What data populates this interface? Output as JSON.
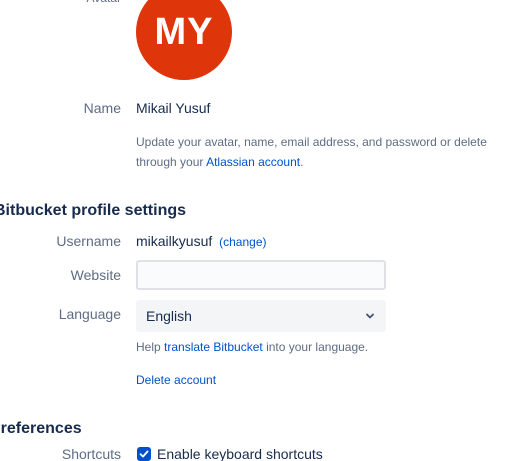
{
  "account": {
    "avatar_label": "Avatar",
    "avatar_initials": "MY",
    "avatar_color": "#de350b",
    "name_label": "Name",
    "name_value": "Mikail Yusuf",
    "help_line1": "Update your avatar, name, email address, and password or delete",
    "help_line2_prefix": "through your ",
    "help_link": "Atlassian account",
    "help_line2_suffix": "."
  },
  "profile": {
    "section_title": "Bitbucket profile settings",
    "username_label": "Username",
    "username_value": "mikailkyusuf",
    "change_link": "(change)",
    "website_label": "Website",
    "website_value": "",
    "language_label": "Language",
    "language_value": "English",
    "language_icon": "chevron-down-icon",
    "help_prefix": "Help ",
    "help_link": "translate Bitbucket",
    "help_suffix": " into your language.",
    "delete_link": "Delete account"
  },
  "preferences": {
    "section_title": "Preferences",
    "shortcuts_label": "Shortcuts",
    "shortcuts_checkbox_label": "Enable keyboard shortcuts",
    "shortcuts_checked": true
  },
  "colors": {
    "link": "#0052cc",
    "text": "#172b4d",
    "muted": "#5e6c84",
    "checkbox": "#0052cc"
  }
}
